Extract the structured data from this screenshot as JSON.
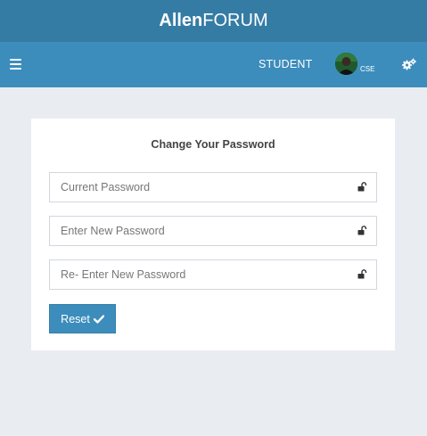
{
  "header": {
    "brand_bold": "Allen",
    "brand_regular": "FORUM"
  },
  "navbar": {
    "role_label": "STUDENT",
    "dept_label": "CSE",
    "menu_icon": "hamburger-icon",
    "settings_icon": "gears-icon"
  },
  "form": {
    "title": "Change Your Password",
    "fields": [
      {
        "placeholder": "Current Password",
        "icon": "unlock-icon"
      },
      {
        "placeholder": "Enter New Password",
        "icon": "unlock-icon"
      },
      {
        "placeholder": "Re- Enter New Password",
        "icon": "unlock-icon"
      }
    ],
    "reset_label": "Reset",
    "reset_icon": "check-icon"
  },
  "colors": {
    "brand_bar": "#357ca5",
    "nav_bar": "#3c8dbc",
    "page_bg": "#e9edf2",
    "button": "#3c8dbc"
  }
}
